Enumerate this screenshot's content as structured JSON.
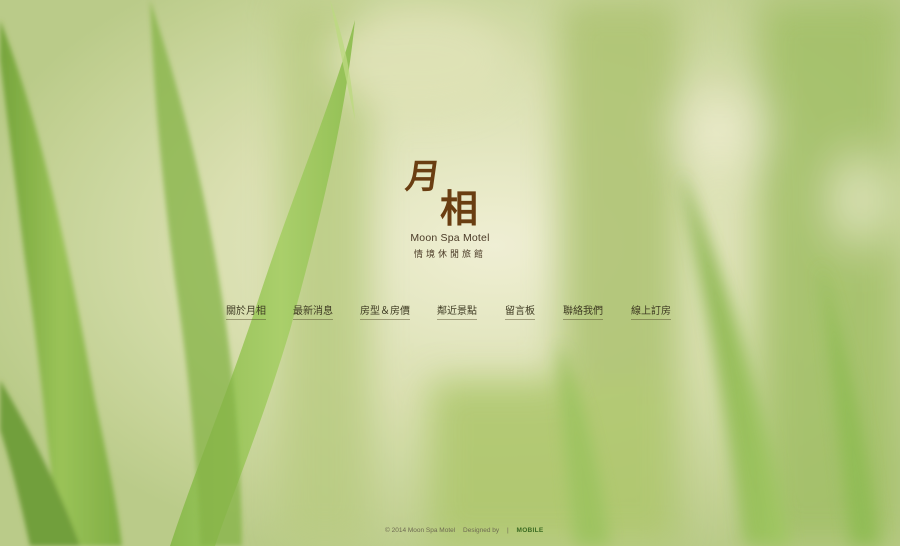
{
  "logo": {
    "char1": "月",
    "char2": "相",
    "name_en": "Moon Spa Motel",
    "subtitle": "情境休閒旅館"
  },
  "nav": {
    "items": [
      {
        "label": "關於月相"
      },
      {
        "label": "最新消息"
      },
      {
        "label": "房型＆房價"
      },
      {
        "label": "鄰近景點"
      },
      {
        "label": "留言板"
      },
      {
        "label": "聯絡我們"
      },
      {
        "label": "線上訂房"
      }
    ]
  },
  "footer": {
    "copyright": "© 2014 Moon Spa Motel",
    "designed_by": "Designed by",
    "separator": "|",
    "designer": "MOBILE"
  },
  "colors": {
    "logo_brown": "#6a3e12",
    "nav_text": "#3e3a22",
    "background_green": "#c9d59a"
  }
}
